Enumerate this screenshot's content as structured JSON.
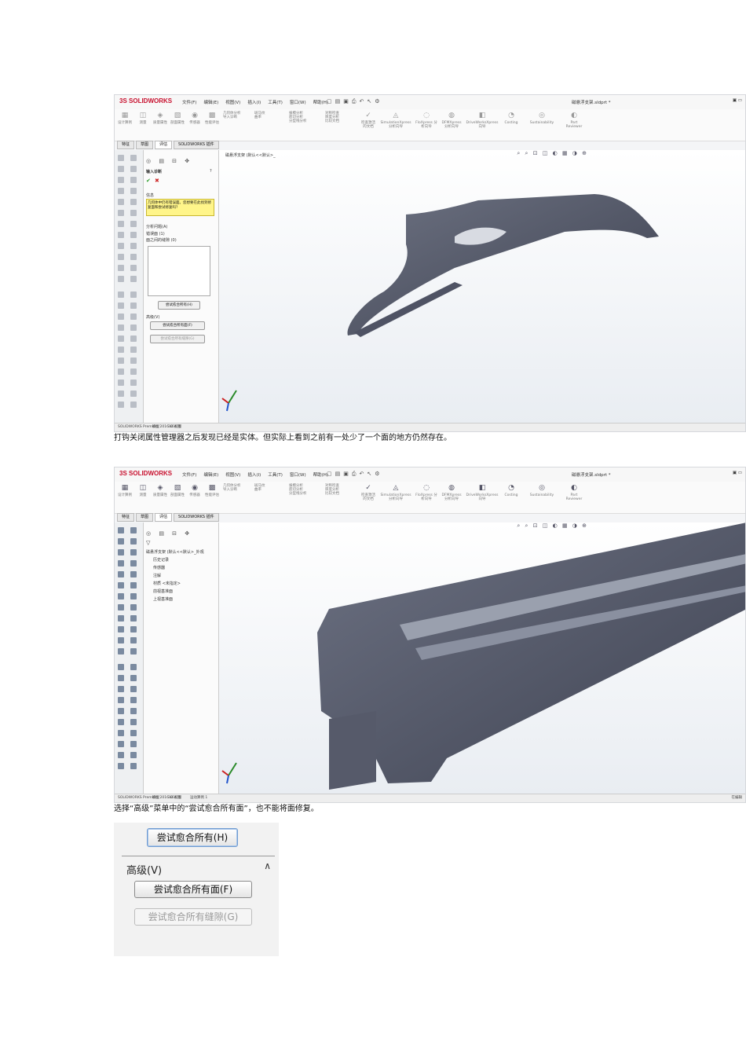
{
  "app": {
    "brand": "SOLIDWORKS",
    "menus": [
      "文件(F)",
      "编辑(E)",
      "视图(V)",
      "插入(I)",
      "工具(T)",
      "窗口(W)",
      "帮助(H)"
    ],
    "document_title": "磁悬浮支架.sldprt *",
    "ribbon": [
      {
        "label": "设计算例",
        "icon": "design-study-icon"
      },
      {
        "label": "测量",
        "icon": "measure-icon"
      },
      {
        "label": "质量属性",
        "icon": "mass-properties-icon"
      },
      {
        "label": "剖面属性",
        "icon": "section-properties-icon"
      },
      {
        "label": "传感器",
        "icon": "sensor-icon"
      },
      {
        "label": "性能评估",
        "icon": "evaluation-icon"
      },
      {
        "label": "几何体分析",
        "icon": "geometry-analysis-icon"
      },
      {
        "label": "导入诊断",
        "icon": "import-diagnostics-icon"
      },
      {
        "label": "斑马纹",
        "icon": "zebra-icon"
      },
      {
        "label": "曲率",
        "icon": "curvature-icon"
      },
      {
        "label": "拔模分析",
        "icon": "draft-analysis-icon"
      },
      {
        "label": "底切分析",
        "icon": "undercut-icon"
      },
      {
        "label": "分型线分析",
        "icon": "parting-line-icon"
      },
      {
        "label": "对称检查",
        "icon": "symmetry-icon"
      },
      {
        "label": "厚度分析",
        "icon": "thickness-icon"
      },
      {
        "label": "比较文档",
        "icon": "compare-icon"
      },
      {
        "label": "检查激活的文档",
        "icon": "check-icon"
      },
      {
        "label": "SimulationXpress 分析向导",
        "icon": "simulation-icon"
      },
      {
        "label": "FloXpress 分析向导",
        "icon": "floxpress-icon"
      },
      {
        "label": "DFMXpress 分析向导",
        "icon": "dfm-icon"
      },
      {
        "label": "DriveWorksXpress 向导",
        "icon": "driveworks-icon"
      },
      {
        "label": "Costing",
        "icon": "costing-icon"
      },
      {
        "label": "Sustainability",
        "icon": "sustainability-icon"
      },
      {
        "label": "Part Reviewer",
        "icon": "reviewer-icon"
      }
    ],
    "tabs": [
      "特征",
      "草图",
      "评估",
      "SOLIDWORKS 插件"
    ],
    "status_text": "SOLIDWORKS Premium 2016 x64 版",
    "bottom_tabs": [
      "模型",
      "3D 视图",
      "运动算例 1"
    ],
    "status_right": "在编辑"
  },
  "shot1": {
    "crumb": "磁悬浮支架 (默认<<默认>_",
    "panel": {
      "title": "输入诊断",
      "ok": "✔",
      "cancel": "✖",
      "section_info": "信息",
      "warning": "几何体中仍有错误面。您想要在此找到修复面和尝试修复吗？",
      "section_problems": "分析问题(A)",
      "problem_items": [
        "错误面 (1)",
        "面之间的缝隙 (0)"
      ],
      "heal_all": "尝试愈合所有(H)",
      "section_adv": "高级(V)",
      "heal_faces": "尝试愈合所有面(F)",
      "heal_gaps": "尝试愈合所有缝隙(G)"
    }
  },
  "caption1": "打钩关闭属性管理器之后发现已经是实体。但实际上看到之前有一处少了一个面的地方仍然存在。",
  "shot2": {
    "tree_items": [
      "磁悬浮支架 (默认<<默认>_外观",
      "历史记录",
      "传感器",
      "注解",
      "材质 <未指定>",
      "前视基准面",
      "上视基准面"
    ]
  },
  "caption2": "选择“高级”菜单中的“尝试愈合所有面”，也不能将面修复。",
  "closeup": {
    "heal_all": "尝试愈合所有(H)",
    "advanced": "高级(V)",
    "heal_faces": "尝试愈合所有面(F)",
    "heal_gaps": "尝试愈合所有缝隙(G)"
  }
}
